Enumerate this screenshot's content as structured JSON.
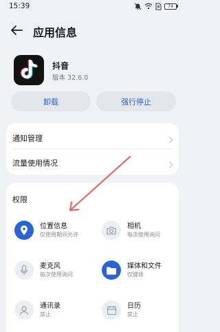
{
  "status_bar": {
    "time": "15:39",
    "battery": "74"
  },
  "header": {
    "title": "应用信息"
  },
  "app": {
    "name": "抖音",
    "version": "版本 32.6.0"
  },
  "actions": {
    "uninstall": "卸载",
    "force_stop": "强行停止"
  },
  "settings": {
    "items": [
      {
        "label": "通知管理"
      },
      {
        "label": "流量使用情况"
      }
    ]
  },
  "permissions": {
    "title": "权限",
    "items": [
      {
        "name": "位置信息",
        "status": "仅使用期间允许",
        "icon": "location-icon",
        "enabled": true
      },
      {
        "name": "相机",
        "status": "每次使用询问",
        "icon": "camera-icon",
        "enabled": false
      },
      {
        "name": "麦克风",
        "status": "每次使用询问",
        "icon": "microphone-icon",
        "enabled": false
      },
      {
        "name": "媒体和文件",
        "status": "仅媒体",
        "icon": "folder-icon",
        "enabled": true
      },
      {
        "name": "通讯录",
        "status": "禁止",
        "icon": "contacts-icon",
        "enabled": false
      },
      {
        "name": "日历",
        "status": "禁止",
        "icon": "calendar-icon",
        "enabled": false
      }
    ]
  },
  "colors": {
    "accent": "#2a63d6",
    "background": "#f1f2f4",
    "card": "#ffffff",
    "annotation_arrow": "#e06a6a"
  }
}
